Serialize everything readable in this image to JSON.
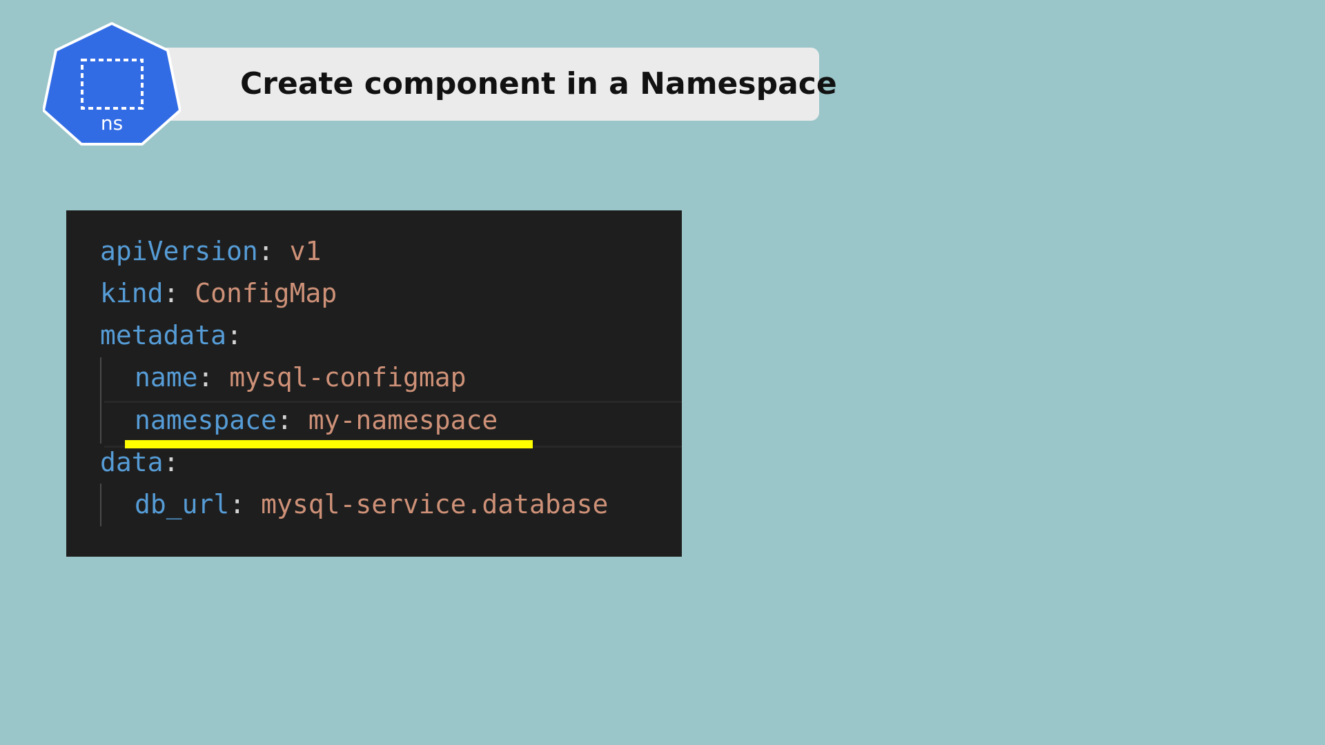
{
  "colors": {
    "background": "#9ac5c9",
    "title_bar": "#ebebeb",
    "ns_icon": "#326ce5",
    "code_background": "#1e1e1e",
    "code_key": "#569cd6",
    "code_value": "#ce9178",
    "code_punct": "#d4d4d4",
    "highlight": "#ffff00"
  },
  "header": {
    "title": "Create component in a Namespace",
    "icon": {
      "name": "kubernetes-namespace-icon",
      "label": "ns"
    }
  },
  "code": {
    "language": "yaml",
    "lines": [
      {
        "key": "apiVersion",
        "sep": ":",
        "value": "v1"
      },
      {
        "key": "kind",
        "sep": ":",
        "value": "ConfigMap"
      },
      {
        "key": "metadata",
        "sep": ":",
        "value": ""
      },
      {
        "key": "name",
        "sep": ":",
        "value": "mysql-configmap"
      },
      {
        "key": "namespace",
        "sep": ":",
        "value": "my-namespace"
      },
      {
        "key": "data",
        "sep": ":",
        "value": ""
      },
      {
        "key": "db_url",
        "sep": ":",
        "value": "mysql-service.database"
      }
    ]
  }
}
